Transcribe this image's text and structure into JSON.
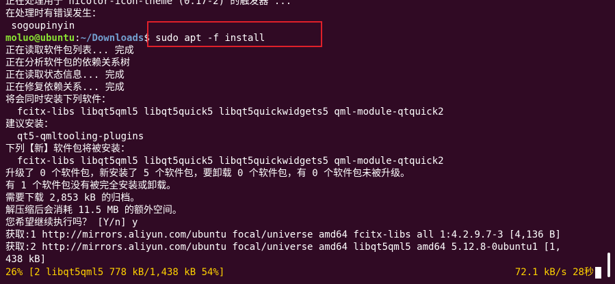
{
  "prompt": {
    "user_host": "moluo@ubuntu",
    "separator": ":",
    "path": "~/Downloads",
    "symbol": "$ ",
    "command": "sudo apt -f install"
  },
  "output_before": [
    "正在处理用于 hicolor-icon-theme (0.17-2) 的触发器 ...",
    "在处理时有错误发生：",
    " sogoupinyin"
  ],
  "output_after": [
    "正在读取软件包列表... 完成",
    "正在分析软件包的依赖关系树",
    "正在读取状态信息... 完成",
    "正在修复依赖关系... 完成",
    "将会同时安装下列软件：",
    "  fcitx-libs libqt5qml5 libqt5quick5 libqt5quickwidgets5 qml-module-qtquick2",
    "建议安装：",
    "  qt5-qmltooling-plugins",
    "下列【新】软件包将被安装：",
    "  fcitx-libs libqt5qml5 libqt5quick5 libqt5quickwidgets5 qml-module-qtquick2",
    "升级了 0 个软件包，新安装了 5 个软件包，要卸载 0 个软件包，有 0 个软件包未被升级。",
    "有 1 个软件包没有被完全安装或卸载。",
    "需要下载 2,853 kB 的归档。",
    "解压缩后会消耗 11.5 MB 的额外空间。",
    "您希望继续执行吗？ [Y/n] y",
    "获取:1 http://mirrors.aliyun.com/ubuntu focal/universe amd64 fcitx-libs all 1:4.2.9.7-3 [4,136 B]",
    "获取:2 http://mirrors.aliyun.com/ubuntu focal/universe amd64 libqt5qml5 amd64 5.12.8-0ubuntu1 [1,",
    "438 kB]"
  ],
  "status": {
    "progress": "26% [2 libqt5qml5 778 kB/1,438 kB 54%]",
    "speed": "72.1 kB/s",
    "eta": " 28秒"
  },
  "colors": {
    "background": "#300a24",
    "prompt_user": "#8ae234",
    "prompt_path": "#729fcf",
    "highlight_box": "#e0202a",
    "status_text": "#ffd200"
  }
}
